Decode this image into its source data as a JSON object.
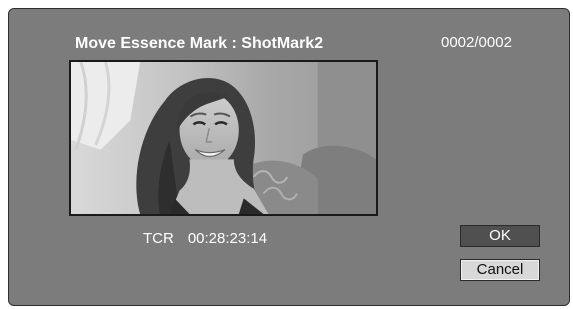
{
  "dialog": {
    "title": "Move Essence Mark : ShotMark2",
    "counter": "0002/0002",
    "timecode": {
      "label": "TCR",
      "value": "00:28:23:14"
    },
    "buttons": {
      "ok_label": "OK",
      "cancel_label": "Cancel"
    },
    "thumbnail": {
      "description_icon": "video-frame-thumbnail"
    }
  },
  "colors": {
    "dialog_bg": "#7c7c7c",
    "ok_button_bg": "#505050",
    "cancel_button_bg": "#d8d8d8",
    "text": "#ffffff"
  }
}
